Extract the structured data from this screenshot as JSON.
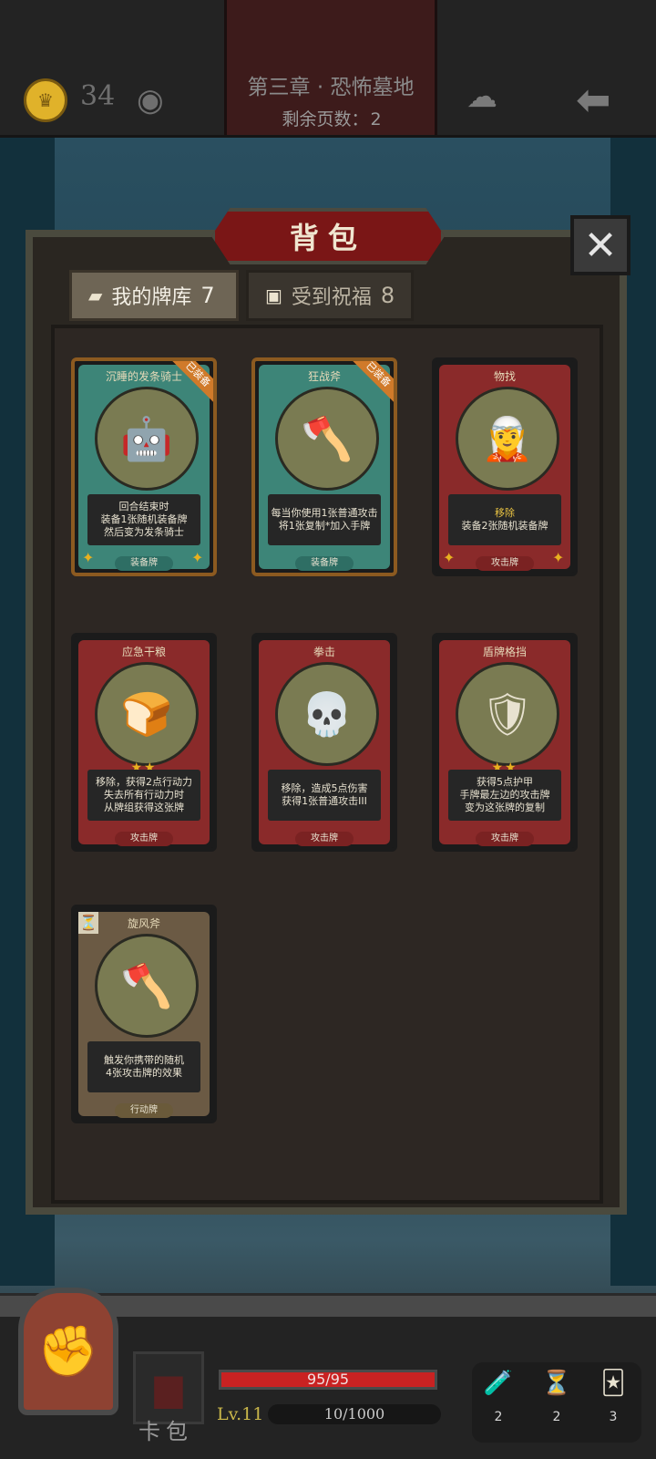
{
  "top_bar": {
    "coins": "34",
    "chapter_title": "第三章 · 恐怖墓地",
    "pages_left_label": "剩余页数：",
    "pages_left_value": "2",
    "icons": [
      "coin-icon",
      "eye-icon",
      "ghost-pumpkin-icon",
      "back-arrow-icon"
    ]
  },
  "panel": {
    "title": "背包",
    "tabs": [
      {
        "label": "我的牌库",
        "count": "7",
        "active": true
      },
      {
        "label": "受到祝福",
        "count": "8",
        "active": false
      }
    ]
  },
  "cards": [
    {
      "name": "沉睡的发条骑士",
      "badge": "已装备",
      "lines": [
        "回合结束时",
        "装备1张随机装备牌",
        "然后变为发条骑士"
      ],
      "type": "装备牌",
      "frame": "teal",
      "art": "🤖"
    },
    {
      "name": "狂战斧",
      "badge": "已装备",
      "lines": [
        "每当你使用1张普通攻击",
        "将1张复制*加入手牌"
      ],
      "type": "装备牌",
      "frame": "teal",
      "art": "🪓"
    },
    {
      "name": "物找",
      "badge": "",
      "lines": [
        "移除",
        "装备2张随机装备牌"
      ],
      "type": "攻击牌",
      "frame": "red",
      "art": "🧝"
    },
    {
      "name": "应急干粮",
      "badge": "",
      "stars": "★★",
      "lines": [
        "移除，获得2点行动力",
        "失去所有行动力时",
        "从牌组获得这张牌"
      ],
      "type": "攻击牌",
      "frame": "red",
      "art": "🍞"
    },
    {
      "name": "拳击",
      "badge": "",
      "lines": [
        "移除，造成5点伤害",
        "获得1张普通攻击III"
      ],
      "type": "攻击牌",
      "frame": "red",
      "art": "💀"
    },
    {
      "name": "盾牌格挡",
      "badge": "",
      "stars": "★★",
      "lines": [
        "获得5点护甲",
        "手牌最左边的攻击牌",
        "变为这张牌的复制"
      ],
      "type": "攻击牌",
      "frame": "red",
      "art": "🛡"
    },
    {
      "name": "旋风斧",
      "badge": "",
      "lines": [
        "触发你携带的随机",
        "4张攻击牌的效果"
      ],
      "type": "行动牌",
      "frame": "brown",
      "art": "🪓",
      "hourglass": "⏳"
    }
  ],
  "bottom_bar": {
    "deck_label": "卡包",
    "hp_text": "95/95",
    "hp_ratio": 1.0,
    "level": "Lv.11",
    "xp_text": "10/1000",
    "items": [
      {
        "icon": "potion-icon",
        "glyph": "🧪",
        "count": "2"
      },
      {
        "icon": "hourglass-icon",
        "glyph": "⏳",
        "count": "2"
      },
      {
        "icon": "cards-icon",
        "glyph": "🃏",
        "count": "3"
      }
    ]
  },
  "colors": {
    "frame_teal": "#3d8578",
    "frame_red": "#8a2a2a",
    "frame_brown": "#6b5a44",
    "type_teal": "#2e6e64",
    "type_red": "#7a2222",
    "type_brown": "#6a5a3a",
    "hp": "#c92222"
  }
}
